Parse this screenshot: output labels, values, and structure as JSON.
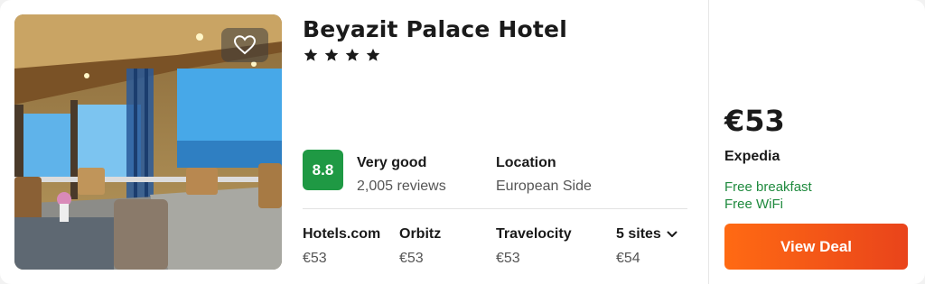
{
  "hotel": {
    "name": "Beyazit Palace Hotel",
    "star_count": 4
  },
  "rating": {
    "score": "8.8",
    "label": "Very good",
    "reviews": "2,005 reviews",
    "color": "#1f9944"
  },
  "location": {
    "title": "Location",
    "value": "European Side"
  },
  "sites": [
    {
      "name": "Hotels.com",
      "price": "€53"
    },
    {
      "name": "Orbitz",
      "price": "€53"
    },
    {
      "name": "Travelocity",
      "price": "€53"
    },
    {
      "name": "5 sites",
      "price": "€54",
      "icon": "chevron-down-icon"
    }
  ],
  "deal": {
    "price": "€53",
    "provider": "Expedia",
    "amenities": [
      "Free breakfast",
      "Free WiFi"
    ],
    "button_label": "View Deal",
    "button_color": "#ff6a13"
  },
  "icons": {
    "favorite": "heart-outline-icon",
    "star": "star-icon"
  }
}
